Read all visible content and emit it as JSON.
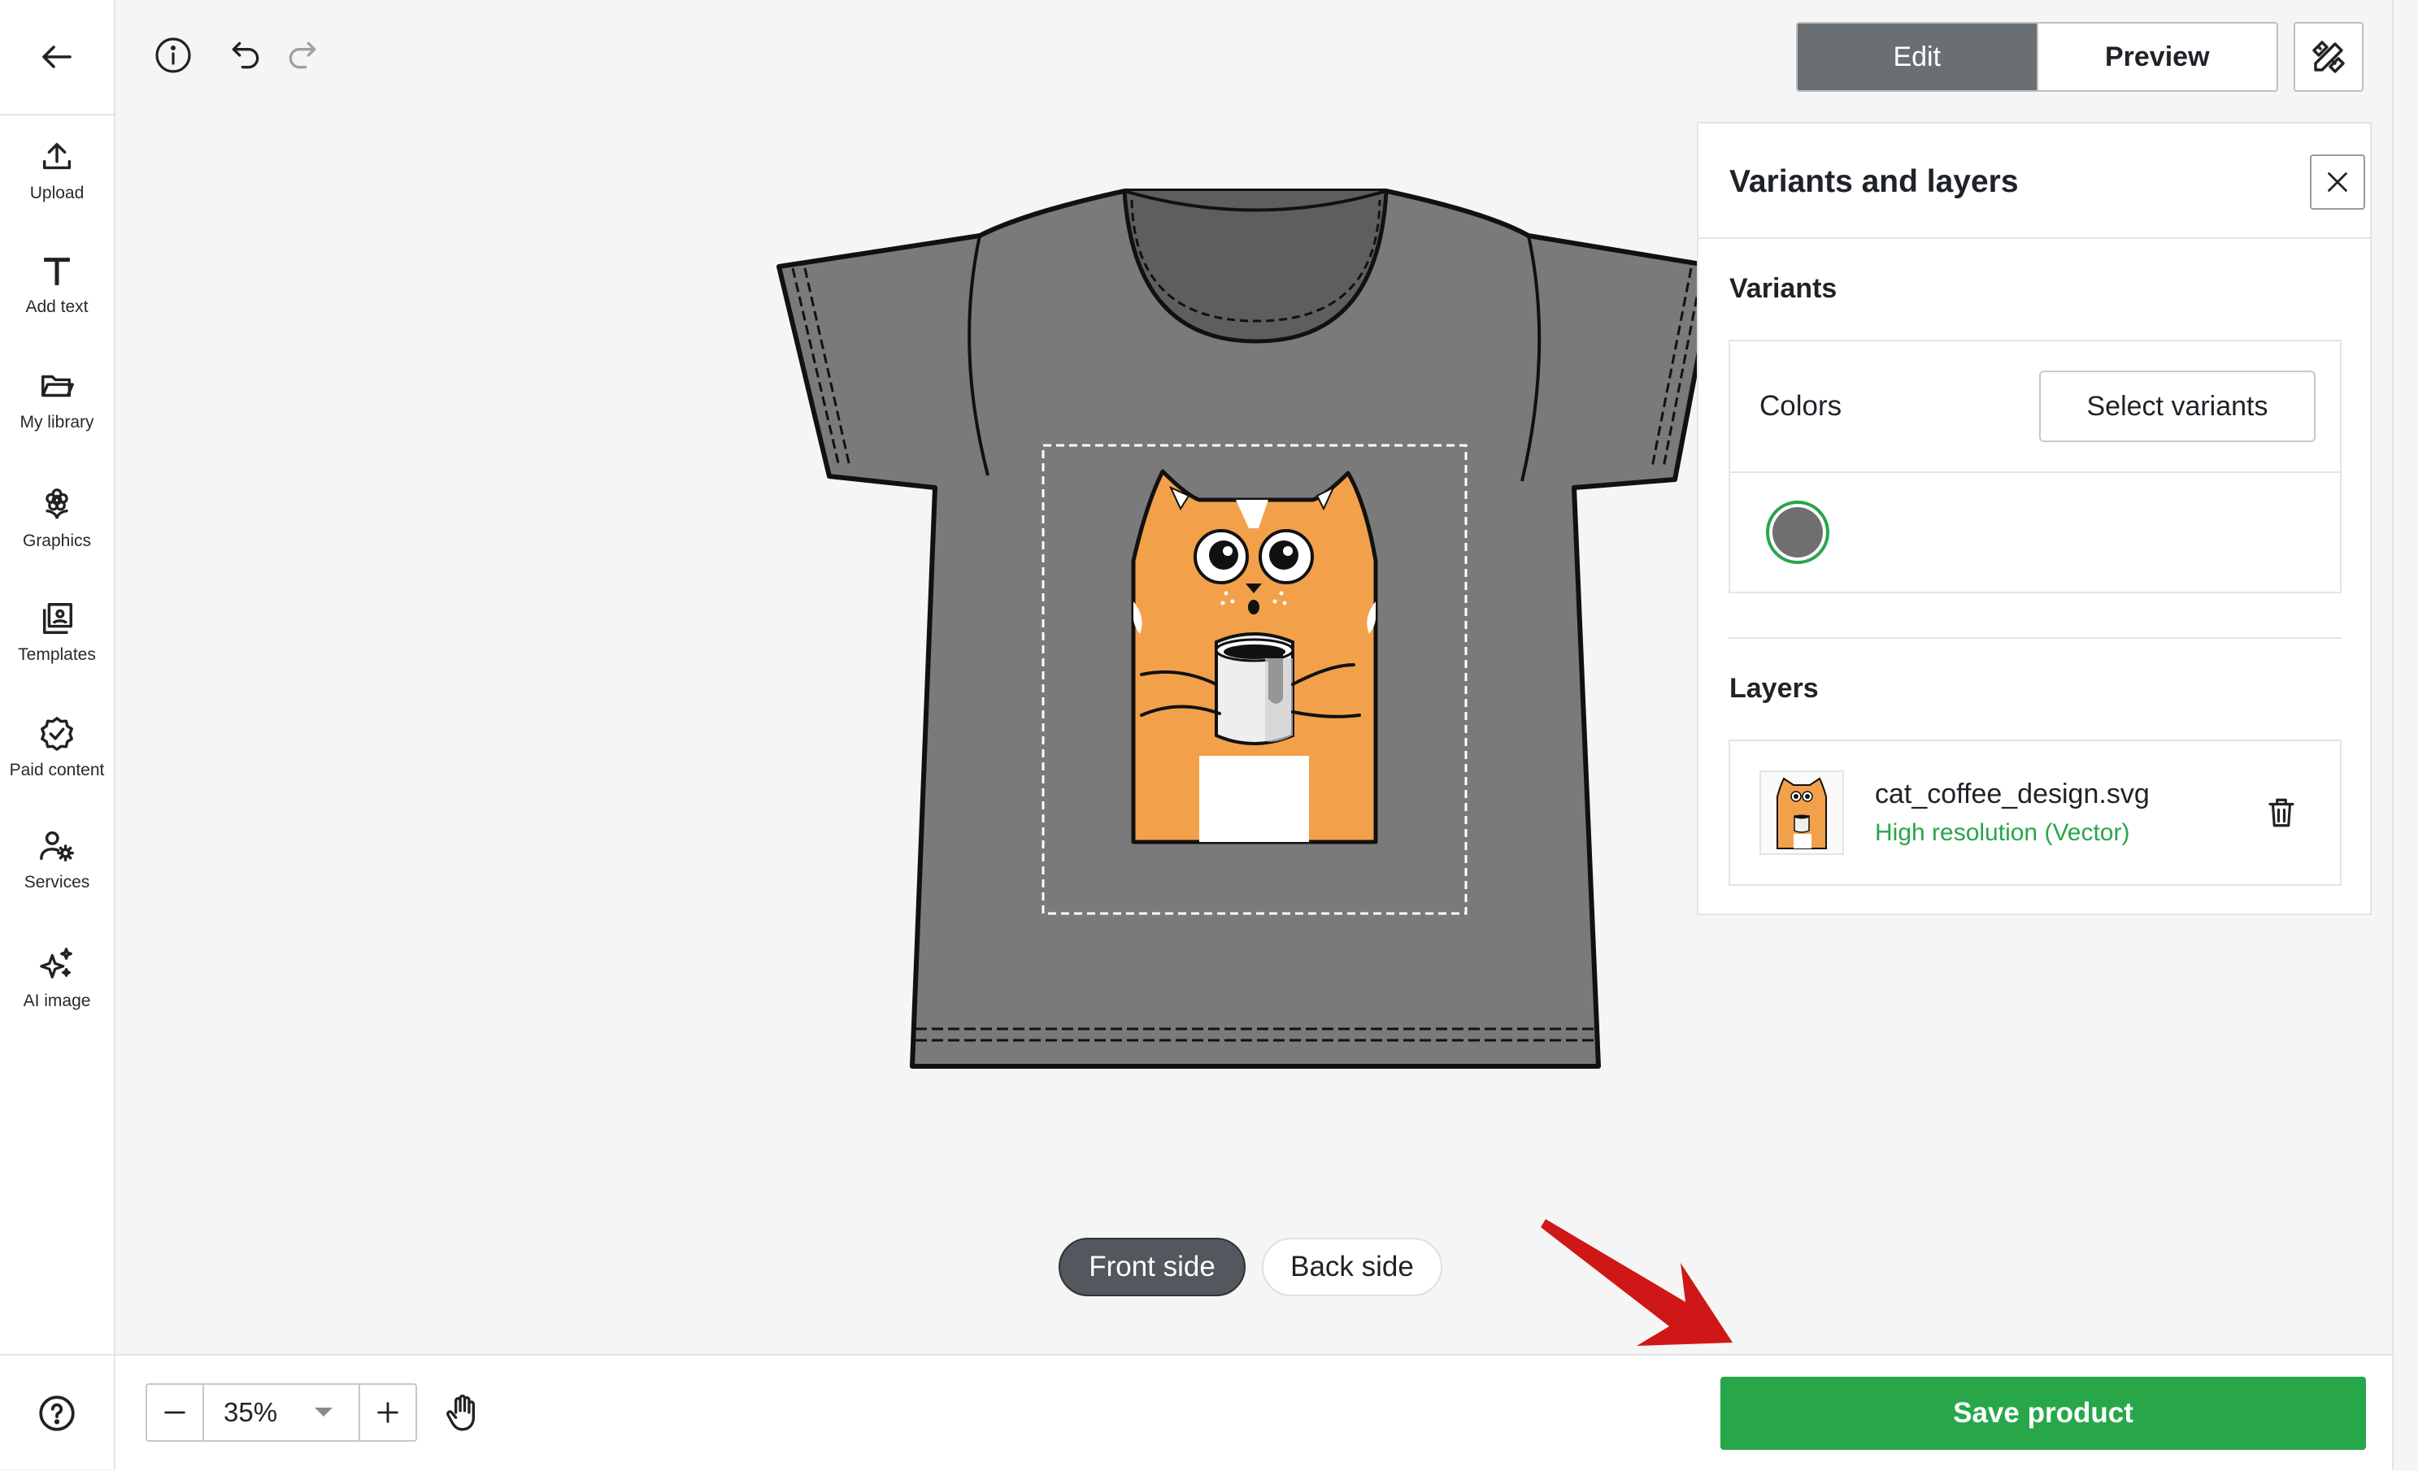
{
  "sidebar": {
    "back_icon": "arrow-left-icon",
    "items": [
      {
        "label": "Upload",
        "icon": "upload-icon"
      },
      {
        "label": "Add text",
        "icon": "text-icon"
      },
      {
        "label": "My library",
        "icon": "folder-icon"
      },
      {
        "label": "Graphics",
        "icon": "flower-icon"
      },
      {
        "label": "Templates",
        "icon": "templates-icon"
      },
      {
        "label": "Paid content",
        "icon": "badge-check-icon"
      },
      {
        "label": "Services",
        "icon": "user-gear-icon"
      },
      {
        "label": "AI image",
        "icon": "sparkle-icon"
      }
    ],
    "help_icon": "help-icon"
  },
  "toolbar": {
    "info_icon": "info-icon",
    "undo_icon": "undo-icon",
    "redo_icon": "redo-icon",
    "edit_label": "Edit",
    "preview_label": "Preview",
    "tools_icon": "design-tools-icon"
  },
  "panel": {
    "title": "Variants and layers",
    "variants_heading": "Variants",
    "colors_label": "Colors",
    "select_variants_label": "Select variants",
    "selected_color": "#6f6f6f",
    "layers_heading": "Layers",
    "layer": {
      "name": "cat_coffee_design.svg",
      "resolution": "High resolution (Vector)"
    }
  },
  "canvas": {
    "product_color": "#7a7a7a",
    "front_label": "Front side",
    "back_label": "Back side"
  },
  "bottom": {
    "zoom_value": "35%",
    "save_label": "Save product"
  },
  "colors": {
    "accent_green": "#27a74a",
    "dark_tab": "#6a6f74",
    "annotation_arrow": "#d01717"
  }
}
